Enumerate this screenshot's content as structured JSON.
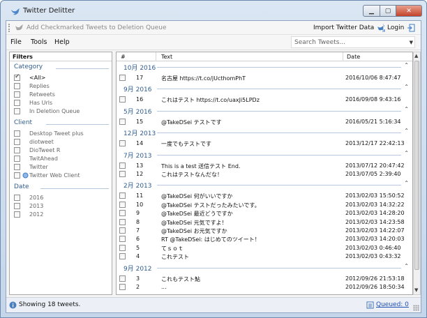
{
  "window": {
    "title": "Twitter Delitter"
  },
  "toolbar": {
    "add_to_queue": "Add Checkmarked Tweets to Deletion Queue",
    "import": "Import Twitter Data",
    "login": "Login"
  },
  "menu": {
    "file": "File",
    "tools": "Tools",
    "help": "Help"
  },
  "search": {
    "placeholder": "Search Tweets..."
  },
  "filters": {
    "header": "Filters",
    "category_title": "Category",
    "category": [
      "<All>",
      "Replies",
      "Retweets",
      "Has Urls",
      "In Deletion Queue"
    ],
    "client_title": "Client",
    "client": [
      "Desktop Tweet plus",
      "diotweet",
      "DioTweet R",
      "TwitAhead",
      "Twitter",
      "Twitter Web Client"
    ],
    "date_title": "Date",
    "date": [
      "2016",
      "2013",
      "2012"
    ]
  },
  "grid": {
    "col_num": "#",
    "col_text": "Text",
    "col_date": "Date",
    "groups": [
      {
        "label": "10月 2016",
        "rows": [
          {
            "num": "17",
            "text": "名古屋 https://t.co/jUcthomPhT",
            "date": "2016/10/06 8:47:47"
          }
        ]
      },
      {
        "label": "9月 2016",
        "rows": [
          {
            "num": "16",
            "text": "これはテスト https://t.co/uaxJi5LPDz",
            "date": "2016/09/08 9:43:16"
          }
        ]
      },
      {
        "label": "5月 2016",
        "rows": [
          {
            "num": "15",
            "text": "@TakeDSei テストです",
            "date": "2016/05/21 5:16:34"
          }
        ]
      },
      {
        "label": "12月 2013",
        "rows": [
          {
            "num": "14",
            "text": "一度でもテストです",
            "date": "2013/12/17 22:42:13"
          }
        ]
      },
      {
        "label": "7月 2013",
        "rows": [
          {
            "num": "13",
            "text": "This is a test 送信テスト End.",
            "date": "2013/07/12 20:47:42"
          },
          {
            "num": "12",
            "text": "これはテストなんだな！",
            "date": "2013/07/05 2:39:40"
          }
        ]
      },
      {
        "label": "2月 2013",
        "rows": [
          {
            "num": "11",
            "text": "@TakeDSei 何がいいですか",
            "date": "2013/02/03 15:50:52"
          },
          {
            "num": "10",
            "text": "@TakeDSei テストだったみたいです。",
            "date": "2013/02/03 14:32:22"
          },
          {
            "num": "9",
            "text": "@TakeDSei 最近どうですか",
            "date": "2013/02/03 14:28:20"
          },
          {
            "num": "8",
            "text": "@TakeDSei 元気ですよ！",
            "date": "2013/02/03 14:23:58"
          },
          {
            "num": "7",
            "text": "@TakeDSei お元気ですか",
            "date": "2013/02/03 14:22:07"
          },
          {
            "num": "6",
            "text": "RT @TakeDSei: はじめてのツイート！",
            "date": "2013/02/03 14:20:03"
          },
          {
            "num": "5",
            "text": "てｓｏｔ",
            "date": "2013/02/03 0:46:40"
          },
          {
            "num": "4",
            "text": "これテスト",
            "date": "2013/02/03 0:43:32"
          }
        ]
      },
      {
        "label": "9月 2012",
        "rows": [
          {
            "num": "3",
            "text": "これもテスト鮎",
            "date": "2012/09/26 21:53:18"
          },
          {
            "num": "2",
            "text": "...",
            "date": "2012/09/26 18:50:34"
          }
        ]
      }
    ]
  },
  "status": {
    "text": "Showing 18 tweets.",
    "queued": "Queued: 0"
  },
  "colors": {
    "accent": "#2f5c8f",
    "link": "#1f4fb5",
    "frame": "#c5d6ea"
  }
}
